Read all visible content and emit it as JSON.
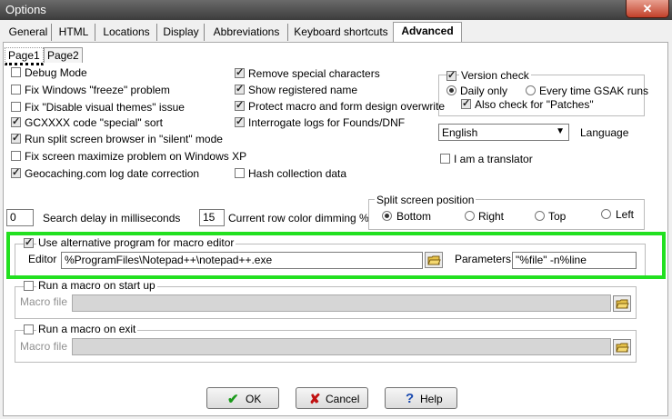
{
  "window": {
    "title": "Options",
    "close_glyph": "✕"
  },
  "tabs": [
    {
      "label": "General"
    },
    {
      "label": "HTML"
    },
    {
      "label": "Locations"
    },
    {
      "label": "Display"
    },
    {
      "label": "Abbreviations"
    },
    {
      "label": "Keyboard shortcuts"
    },
    {
      "label": "Advanced",
      "active": true
    }
  ],
  "subtabs": [
    {
      "label": "Page1",
      "active": true
    },
    {
      "label": "Page2"
    }
  ],
  "left_checks": [
    {
      "label": "Debug Mode",
      "checked": false
    },
    {
      "label": "Fix Windows \"freeze\" problem",
      "checked": false
    },
    {
      "label": "Fix \"Disable visual themes\" issue",
      "checked": false
    },
    {
      "label": "GCXXXX code \"special\" sort",
      "checked": true
    },
    {
      "label": "Run split screen browser in \"silent\" mode",
      "checked": true
    },
    {
      "label": "Fix screen maximize problem on Windows XP",
      "checked": false
    },
    {
      "label": "Geocaching.com log date correction",
      "checked": true
    }
  ],
  "mid_checks": [
    {
      "label": "Remove special characters",
      "checked": true
    },
    {
      "label": "Show registered name",
      "checked": true
    },
    {
      "label": "Protect macro and form design overwrite",
      "checked": true
    },
    {
      "label": "Interrogate logs for Founds/DNF",
      "checked": true
    },
    {
      "label": "Hash collection data",
      "checked": false
    }
  ],
  "version_check": {
    "label": "Version check",
    "checked": true,
    "daily": "Daily only",
    "every": "Every time GSAK runs",
    "patches": "Also check for \"Patches\"",
    "selected": "daily"
  },
  "language": {
    "value": "English",
    "label": "Language",
    "arrow": "▼"
  },
  "translator": {
    "label": "I am a translator",
    "checked": false
  },
  "search_delay": {
    "value": "0",
    "label": "Search delay in milliseconds"
  },
  "dimming": {
    "value": "15",
    "label": "Current row color dimming %"
  },
  "split_screen": {
    "label": "Split screen position",
    "options": [
      "Bottom",
      "Right",
      "Top",
      "Left"
    ],
    "selected": "Bottom"
  },
  "macro_editor": {
    "label": "Use alternative program for macro editor",
    "checked": true,
    "editor_label": "Editor",
    "editor_value": "%ProgramFiles\\Notepad++\\notepad++.exe",
    "params_label": "Parameters",
    "params_value": "\"%file\" -n%line"
  },
  "startup_macro": {
    "label": "Run a macro on start up",
    "file_label": "Macro file",
    "checked": false
  },
  "exit_macro": {
    "label": "Run a macro on exit",
    "file_label": "Macro file",
    "checked": false
  },
  "buttons": {
    "ok": "OK",
    "cancel": "Cancel",
    "help": "Help",
    "ok_icon": "✔",
    "cancel_icon": "✘",
    "help_icon": "?"
  },
  "colors": {
    "highlight": "#22e020",
    "ok_icon": "#1a9a1a",
    "cancel_icon": "#c01010",
    "help_icon": "#1a4ab0"
  }
}
